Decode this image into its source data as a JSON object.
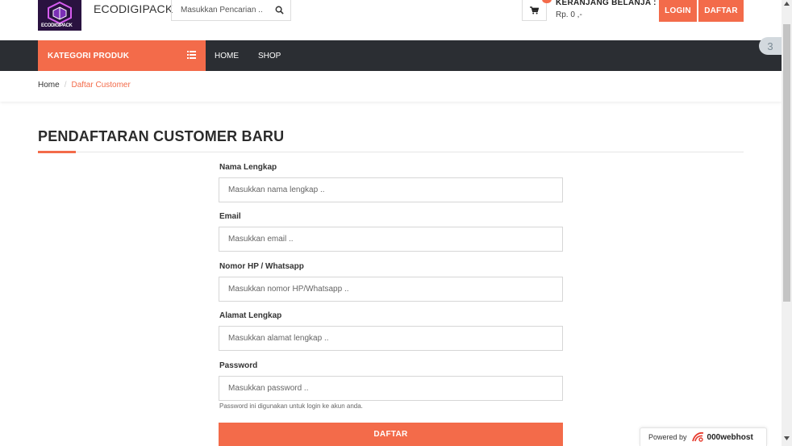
{
  "header": {
    "logo_text": "ECODIGIPACK",
    "brand": "ECODIGIPACK",
    "search_placeholder": "Masukkan Pencarian ..",
    "cart_title": "KERANJANG BELANJA :",
    "cart_total": "Rp. 0 ,-",
    "login_label": "LOGIN",
    "register_label": "DAFTAR"
  },
  "nav": {
    "category_label": "KATEGORI PRODUK",
    "links": [
      "HOME",
      "SHOP"
    ]
  },
  "breadcrumb": {
    "home": "Home",
    "separator": "/",
    "current": "Daftar Customer"
  },
  "page": {
    "title": "PENDAFTARAN CUSTOMER BARU"
  },
  "form": {
    "fields": [
      {
        "label": "Nama Lengkap",
        "placeholder": "Masukkan nama lengkap .."
      },
      {
        "label": "Email",
        "placeholder": "Masukkan email .."
      },
      {
        "label": "Nomor HP / Whatsapp",
        "placeholder": "Masukkan nomor HP/Whatsapp .."
      },
      {
        "label": "Alamat Lengkap",
        "placeholder": "Masukkan alamat lengkap .."
      },
      {
        "label": "Password",
        "placeholder": "Masukkan password .."
      }
    ],
    "password_help": "Password ini digunakan untuk login ke akun anda.",
    "submit_label": "DAFTAR"
  },
  "floating_tab": "3",
  "powered": {
    "text": "Powered by",
    "brand": "000webhost"
  },
  "colors": {
    "accent": "#f36b4a",
    "navbar": "#2b2e33",
    "logo_bg": "#2a1240"
  },
  "icons": {
    "search": "search-icon",
    "cart": "cart-icon",
    "menu": "menu-icon"
  }
}
